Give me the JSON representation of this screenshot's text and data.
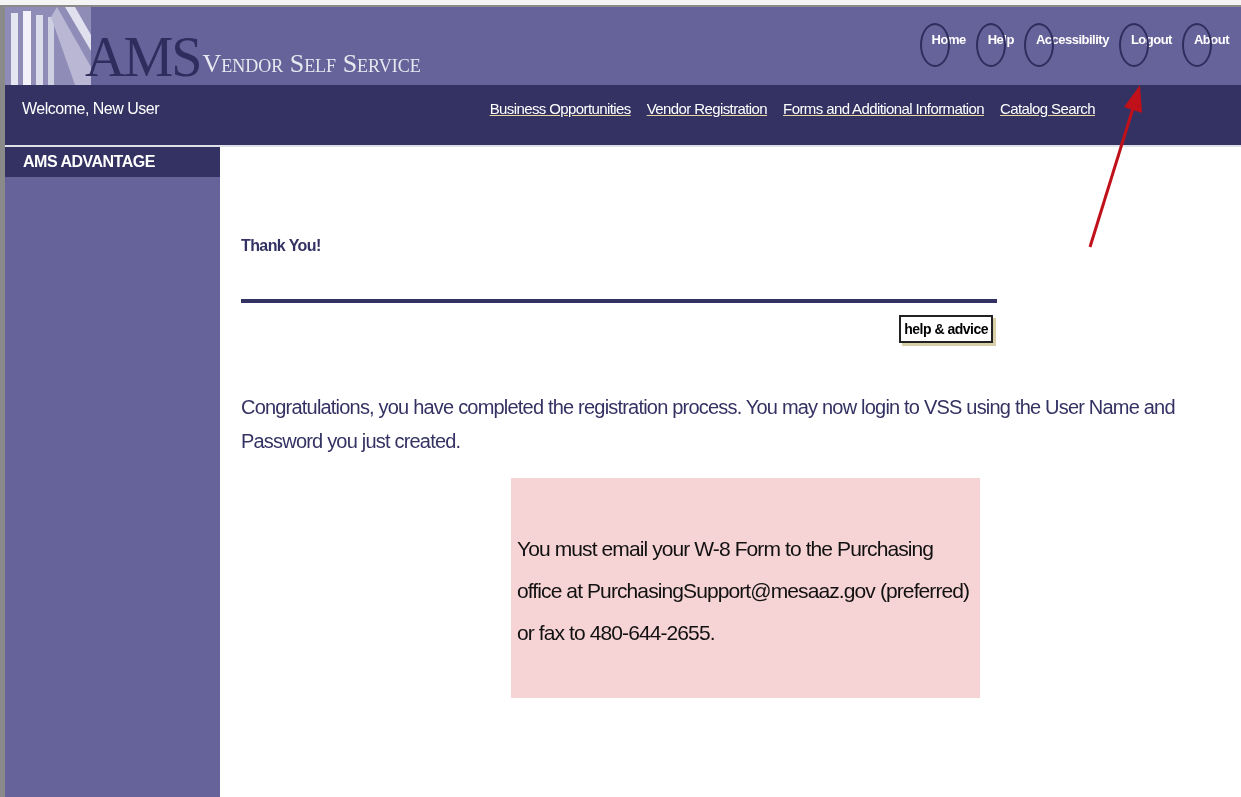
{
  "header": {
    "logo_mark": "AMS",
    "logo_title": "Vendor Self Service",
    "top_links": [
      {
        "label": "Home"
      },
      {
        "label": "Help"
      },
      {
        "label": "Accessibility"
      },
      {
        "label": "Logout"
      },
      {
        "label": "About"
      }
    ]
  },
  "nav_bar": {
    "welcome": "Welcome, New User",
    "links": [
      {
        "label": "Business Opportunities"
      },
      {
        "label": "Vendor Registration"
      },
      {
        "label": "Forms and Additional Information"
      },
      {
        "label": "Catalog Search"
      }
    ]
  },
  "sidebar": {
    "heading": "AMS ADVANTAGE"
  },
  "main": {
    "title": "Thank You!",
    "help_button": "help & advice",
    "message": "Congratulations, you have completed the registration process. You may now login to VSS using the User Name and Password you just created.",
    "notice": "You must email your W-8 Form to the Purchasing office at PurchasingSupport@mesaaz.gov (preferred) or fax to 480-644-2655."
  }
}
